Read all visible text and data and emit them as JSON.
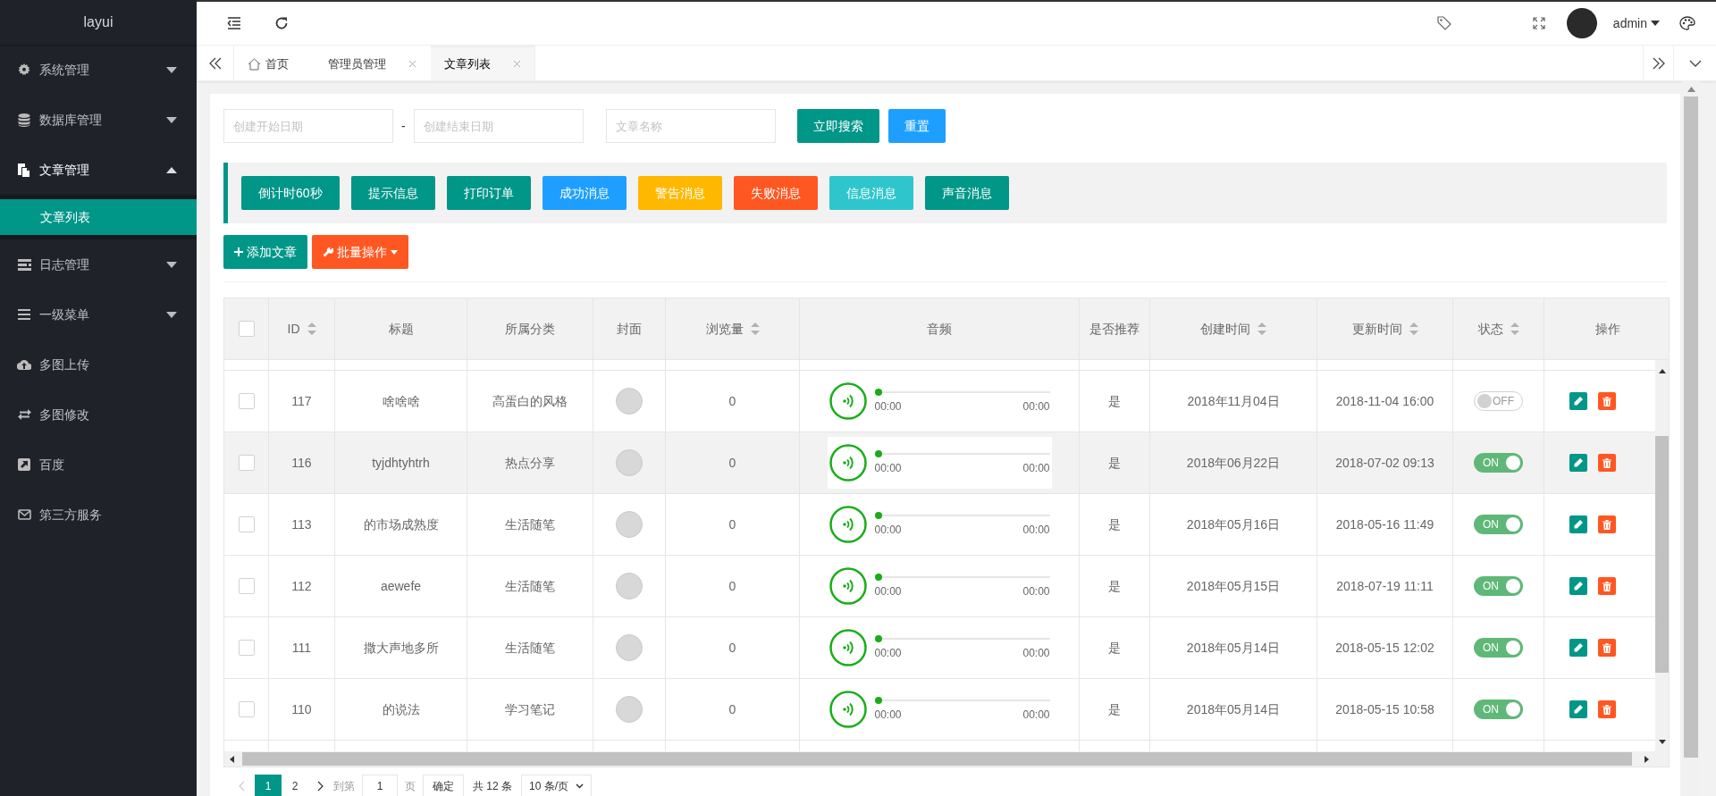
{
  "sidebar": {
    "logo": "layui",
    "items": [
      {
        "label": "系统管理",
        "kind": "group",
        "expanded": false
      },
      {
        "label": "数据库管理",
        "kind": "group",
        "expanded": false
      },
      {
        "label": "文章管理",
        "kind": "group",
        "expanded": true,
        "children": [
          {
            "label": "文章列表",
            "selected": true
          }
        ]
      },
      {
        "label": "日志管理",
        "kind": "group",
        "expanded": false
      },
      {
        "label": "一级菜单",
        "kind": "group",
        "expanded": false
      },
      {
        "label": "多图上传",
        "kind": "link"
      },
      {
        "label": "多图修改",
        "kind": "link"
      },
      {
        "label": "百度",
        "kind": "link"
      },
      {
        "label": "第三方服务",
        "kind": "link"
      }
    ]
  },
  "header": {
    "user": "admin"
  },
  "tabs": [
    {
      "label": "首页",
      "closable": false,
      "selected": false
    },
    {
      "label": "管理员管理",
      "closable": true,
      "selected": false
    },
    {
      "label": "文章列表",
      "closable": true,
      "selected": true
    }
  ],
  "filters": {
    "start_date": {
      "placeholder": "创建开始日期"
    },
    "separator": "-",
    "end_date": {
      "placeholder": "创建结束日期"
    },
    "name": {
      "placeholder": "文章名称"
    },
    "search_button": "立即搜索",
    "reset_button": "重置"
  },
  "message_buttons": [
    {
      "label": "倒计时60秒",
      "color": "#009688"
    },
    {
      "label": "提示信息",
      "color": "#009688"
    },
    {
      "label": "打印订单",
      "color": "#009688"
    },
    {
      "label": "成功消息",
      "color": "#1e9fff"
    },
    {
      "label": "警告消息",
      "color": "#ffb800"
    },
    {
      "label": "失败消息",
      "color": "#ff5722"
    },
    {
      "label": "信息消息",
      "color": "#2ec6cc"
    },
    {
      "label": "声音消息",
      "color": "#009688"
    }
  ],
  "toolbar": {
    "add_button": "添加文章",
    "batch_button": "批量操作"
  },
  "table": {
    "all_checked": false,
    "columns": [
      {
        "label": "ID",
        "sortable": true
      },
      {
        "label": "标题",
        "sortable": false
      },
      {
        "label": "所属分类",
        "sortable": false
      },
      {
        "label": "封面",
        "sortable": false
      },
      {
        "label": "浏览量",
        "sortable": true
      },
      {
        "label": "音频",
        "sortable": false
      },
      {
        "label": "是否推荐",
        "sortable": false
      },
      {
        "label": "创建时间",
        "sortable": true
      },
      {
        "label": "更新时间",
        "sortable": true
      },
      {
        "label": "状态",
        "sortable": true
      },
      {
        "label": "操作",
        "sortable": false
      }
    ],
    "rows": [
      {
        "checked": false,
        "highlighted": false,
        "id": "117",
        "title": "啥啥啥",
        "category": "高蛋白的风格",
        "views": "0",
        "audio": {
          "current": "00:00",
          "total": "00:00",
          "level": 0
        },
        "recommended": "是",
        "created": "2018年11月04日",
        "updated": "2018-11-04 16:00",
        "status": {
          "on": false,
          "label": "OFF"
        }
      },
      {
        "checked": false,
        "highlighted": true,
        "id": "116",
        "title": "tyjdhtyhtrh",
        "category": "热点分享",
        "views": "0",
        "audio": {
          "current": "00:00",
          "total": "00:00",
          "level": 0
        },
        "recommended": "是",
        "created": "2018年06月22日",
        "updated": "2018-07-02 09:13",
        "status": {
          "on": true,
          "label": "ON"
        }
      },
      {
        "checked": false,
        "highlighted": false,
        "id": "113",
        "title": "的市场成熟度",
        "category": "生活随笔",
        "views": "0",
        "audio": {
          "current": "00:00",
          "total": "00:00",
          "level": 0
        },
        "recommended": "是",
        "created": "2018年05月16日",
        "updated": "2018-05-16 11:49",
        "status": {
          "on": true,
          "label": "ON"
        }
      },
      {
        "checked": false,
        "highlighted": false,
        "id": "112",
        "title": "aewefe",
        "category": "生活随笔",
        "views": "0",
        "audio": {
          "current": "00:00",
          "total": "00:00",
          "level": 0
        },
        "recommended": "是",
        "created": "2018年05月15日",
        "updated": "2018-07-19 11:11",
        "status": {
          "on": true,
          "label": "ON"
        }
      },
      {
        "checked": false,
        "highlighted": false,
        "id": "111",
        "title": "撒大声地多所",
        "category": "生活随笔",
        "views": "0",
        "audio": {
          "current": "00:00",
          "total": "00:00",
          "level": 0
        },
        "recommended": "是",
        "created": "2018年05月14日",
        "updated": "2018-05-15 12:02",
        "status": {
          "on": true,
          "label": "ON"
        }
      },
      {
        "checked": false,
        "highlighted": false,
        "id": "110",
        "title": "的说法",
        "category": "学习笔记",
        "views": "0",
        "audio": {
          "current": "00:00",
          "total": "00:00",
          "level": 0
        },
        "recommended": "是",
        "created": "2018年05月14日",
        "updated": "2018-05-15 10:58",
        "status": {
          "on": true,
          "label": "ON"
        }
      }
    ]
  },
  "pagination": {
    "pages": [
      {
        "label": "1",
        "selected": true
      },
      {
        "label": "2",
        "selected": false
      }
    ],
    "goto_label": "到第",
    "goto_value": "1",
    "page_unit": "页",
    "confirm": "确定",
    "total": "共 12 条",
    "page_size": "10 条/页"
  }
}
